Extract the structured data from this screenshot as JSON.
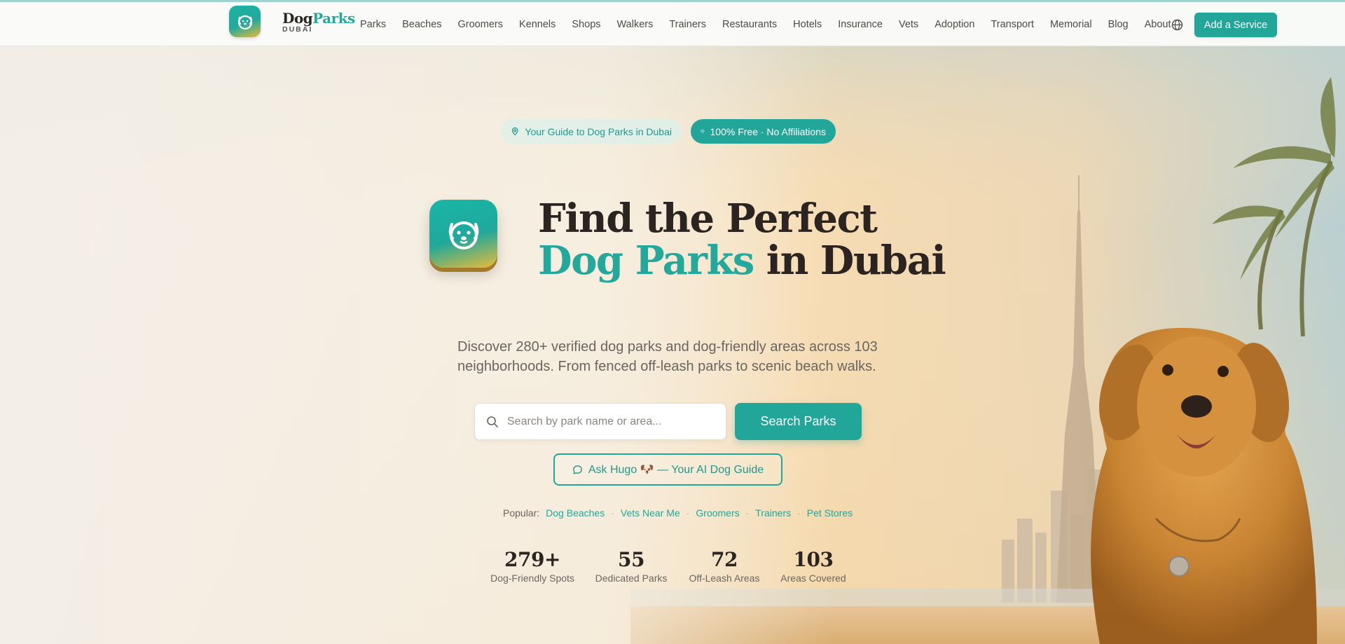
{
  "brand": {
    "name_a": "Dog",
    "name_b": "Parks",
    "sub": "DUBAI"
  },
  "nav": {
    "items": [
      "Parks",
      "Beaches",
      "Groomers",
      "Kennels",
      "Shops",
      "Walkers",
      "Trainers",
      "Restaurants",
      "Hotels",
      "Insurance",
      "Vets",
      "Adoption",
      "Transport",
      "Memorial",
      "Blog",
      "About"
    ],
    "cta": "Add a Service"
  },
  "hero": {
    "pill_guide": "Your Guide to Dog Parks in Dubai",
    "pill_free": "100% Free · No Affiliations",
    "title_line1": "Find the Perfect",
    "title_accent": "Dog Parks",
    "title_rest": " in Dubai",
    "description": "Discover 280+ verified dog parks and dog-friendly areas across 103 neighborhoods. From fenced off-leash parks to scenic beach walks.",
    "search_placeholder": "Search by park name or area...",
    "search_button": "Search Parks",
    "ask_button": "Ask Hugo 🐶 — Your AI Dog Guide",
    "popular_label": "Popular:",
    "popular_links": [
      "Dog Beaches",
      "Vets Near Me",
      "Groomers",
      "Trainers",
      "Pet Stores"
    ]
  },
  "stats": [
    {
      "value": "279+",
      "label": "Dog-Friendly Spots"
    },
    {
      "value": "55",
      "label": "Dedicated Parks"
    },
    {
      "value": "72",
      "label": "Off-Leash Areas"
    },
    {
      "value": "103",
      "label": "Areas Covered"
    }
  ],
  "colors": {
    "accent": "#23a69a",
    "dark": "#2b2420"
  }
}
